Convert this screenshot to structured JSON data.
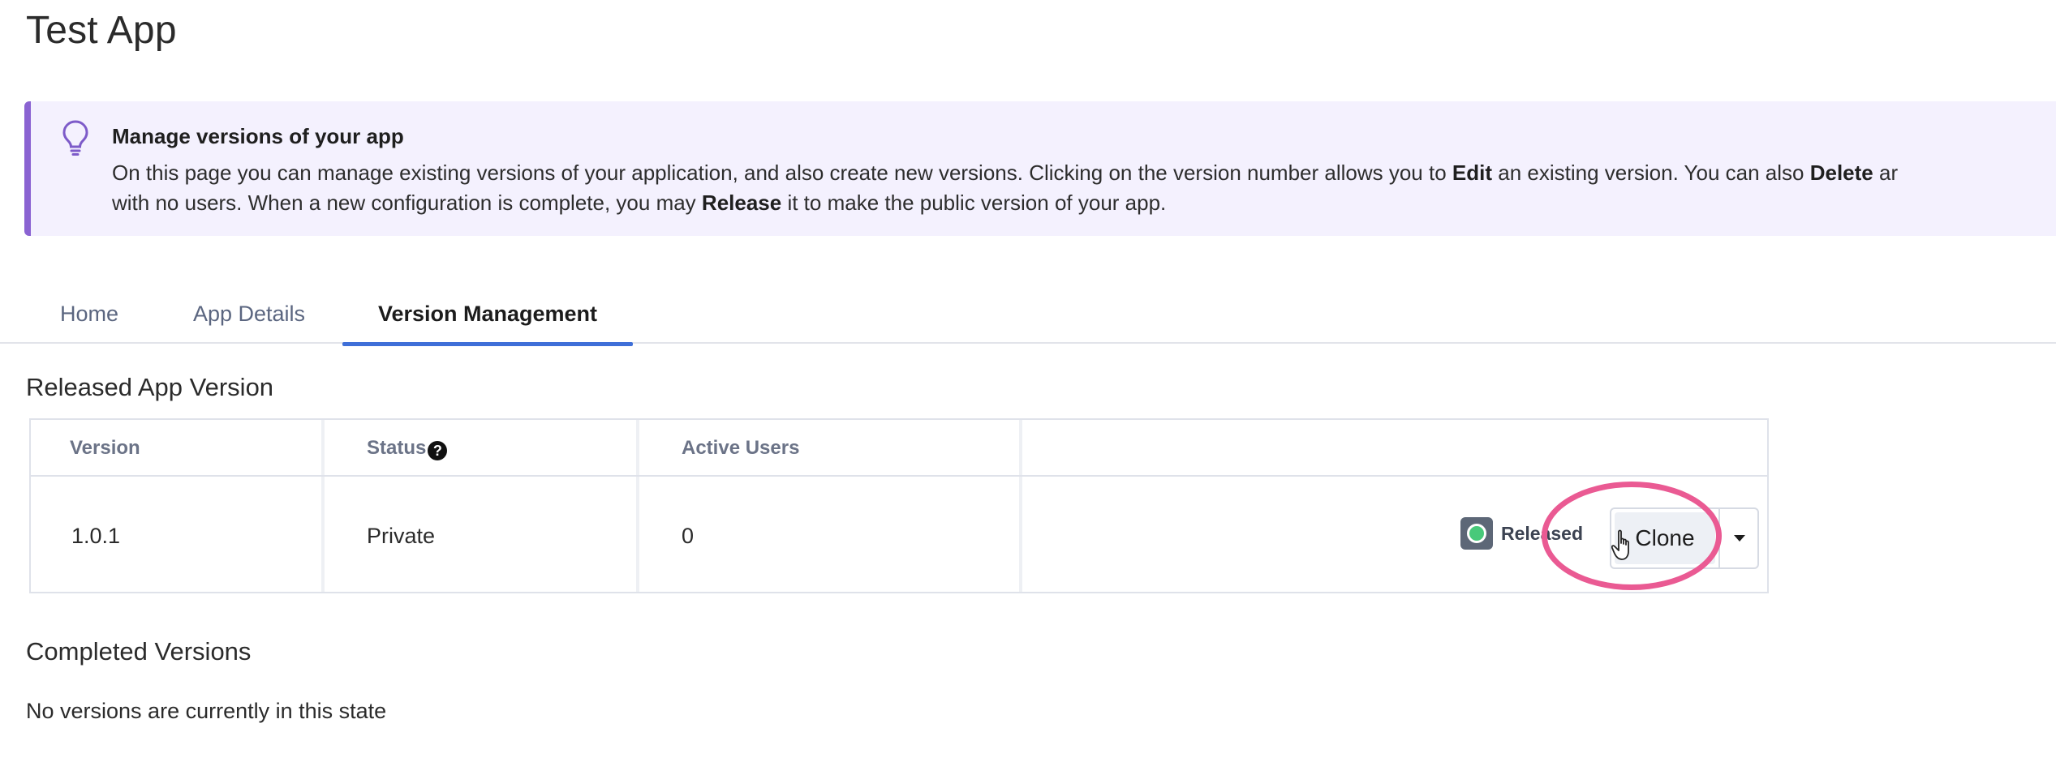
{
  "page": {
    "title": "Test App"
  },
  "banner": {
    "icon": "lightbulb-icon",
    "accent_color": "#8a63d2",
    "background_color": "#f4f1fe",
    "title": "Manage versions of your app",
    "line1": {
      "part1": "On this page you can manage existing versions of your application, and also create new versions. Clicking on the version number allows you to ",
      "bold1": "Edit",
      "part2": " an existing version. You can also ",
      "bold2": "Delete",
      "part3": " ar"
    },
    "line2": {
      "part1": "with no users. When a new configuration is complete, you may ",
      "bold1": "Release",
      "part2": " it to make the public version of your app."
    }
  },
  "tabs": {
    "active_color": "#3f6fd8",
    "items": [
      {
        "label": "Home",
        "active": false
      },
      {
        "label": "App Details",
        "active": false
      },
      {
        "label": "Version Management",
        "active": true
      }
    ]
  },
  "released_section": {
    "title": "Released App Version",
    "columns": [
      "Version",
      "Status",
      "Active Users"
    ],
    "status_help_icon": "question-circle-icon",
    "rows": [
      {
        "version": "1.0.1",
        "status": "Private",
        "active_users": "0",
        "badge": {
          "label": "Released",
          "icon": "status-dot-icon",
          "color": "#48c97a"
        },
        "actions": {
          "clone_label": "Clone",
          "caret_icon": "caret-down-icon"
        }
      }
    ]
  },
  "annotation": {
    "highlight_color": "#ea5a93",
    "cursor_icon": "hand-pointer-icon"
  },
  "completed_section": {
    "title": "Completed Versions",
    "empty_message": "No versions are currently in this state"
  }
}
